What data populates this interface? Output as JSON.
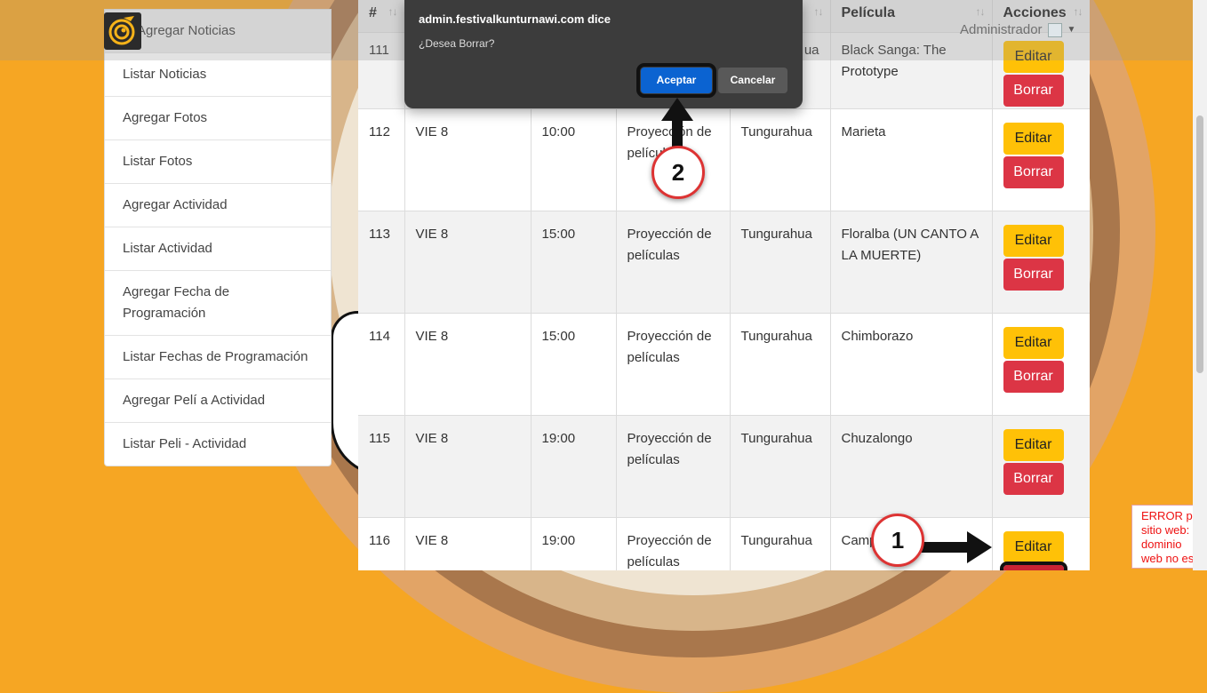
{
  "header": {
    "user_name": "Administrador"
  },
  "sidebar": {
    "items": [
      {
        "label": "Agregar Noticias"
      },
      {
        "label": "Listar Noticias"
      },
      {
        "label": "Agregar Fotos"
      },
      {
        "label": "Listar Fotos"
      },
      {
        "label": "Agregar Actividad"
      },
      {
        "label": "Listar Actividad"
      },
      {
        "label": "Agregar Fecha de Programación"
      },
      {
        "label": "Listar Fechas de Programación"
      },
      {
        "label": "Agregar Pelí a Actividad"
      },
      {
        "label": "Listar Peli - Actividad"
      }
    ]
  },
  "table": {
    "headers": [
      "#",
      "",
      "",
      "",
      "",
      "Película",
      "Acciones"
    ],
    "sort_icon": "↑↓",
    "rows": [
      {
        "id": "111",
        "day": "",
        "time": "",
        "activity": "",
        "province": "…ua",
        "movie": "Black Sanga: The Prototype"
      },
      {
        "id": "112",
        "day": "VIE 8",
        "time": "10:00",
        "activity": "Proyección de películas",
        "province": "Tungurahua",
        "movie": "Marieta"
      },
      {
        "id": "113",
        "day": "VIE 8",
        "time": "15:00",
        "activity": "Proyección de películas",
        "province": "Tungurahua",
        "movie": "Floralba (UN CANTO A LA MUERTE)"
      },
      {
        "id": "114",
        "day": "VIE 8",
        "time": "15:00",
        "activity": "Proyección de películas",
        "province": "Tungurahua",
        "movie": "Chimborazo"
      },
      {
        "id": "115",
        "day": "VIE 8",
        "time": "19:00",
        "activity": "Proyección de películas",
        "province": "Tungurahua",
        "movie": "Chuzalongo"
      },
      {
        "id": "116",
        "day": "VIE 8",
        "time": "19:00",
        "activity": "Proyección de películas",
        "province": "Tungurahua",
        "movie": "Campesino"
      }
    ],
    "edit_label": "Editar",
    "delete_label": "Borrar"
  },
  "dialog": {
    "title": "admin.festivalkunturnawi.com dice",
    "message": "¿Desea Borrar?",
    "ok_label": "Aceptar",
    "cancel_label": "Cancelar"
  },
  "error": {
    "text": "ERROR pa sitio web: el dominio web no es"
  },
  "annotations": {
    "step1": "1",
    "step2": "2"
  },
  "colors": {
    "accent_edit": "#ffc107",
    "accent_delete": "#dc3545",
    "dialog_primary": "#0b63d1",
    "background": "#f6a623"
  }
}
